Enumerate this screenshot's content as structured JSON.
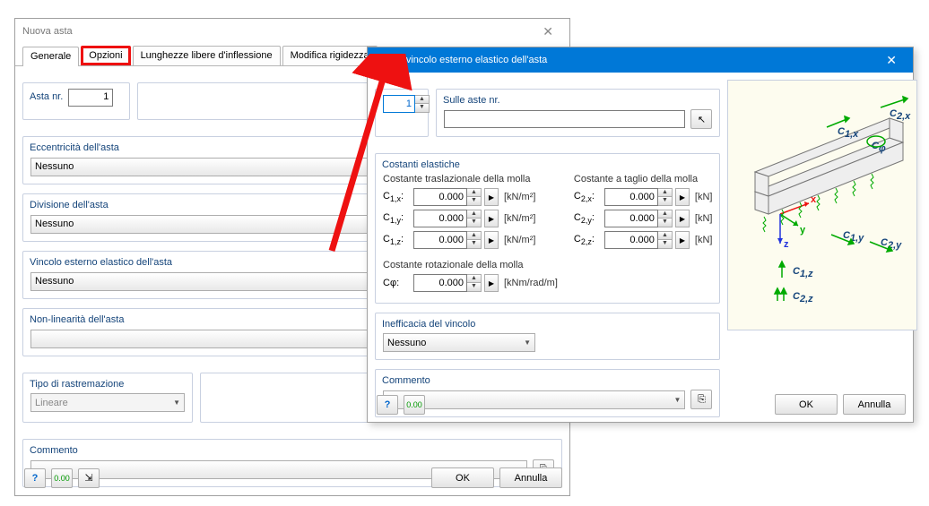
{
  "main": {
    "title": "Nuova asta",
    "tabs": {
      "general": "Generale",
      "options": "Opzioni",
      "buckling": "Lunghezze libere d'inflessione",
      "modify": "Modifica rigidezza"
    },
    "asta_nr": {
      "label": "Asta nr.",
      "value": "1"
    },
    "eccentricity": {
      "label": "Eccentricità dell'asta",
      "value": "Nessuno"
    },
    "division": {
      "label": "Divisione dell'asta",
      "value": "Nessuno"
    },
    "elastic": {
      "label": "Vincolo esterno elastico dell'asta",
      "value": "Nessuno"
    },
    "nonlin": {
      "label": "Non-linearità dell'asta",
      "value": ""
    },
    "taper": {
      "label": "Tipo di rastremazione",
      "value": "Lineare"
    },
    "comment": {
      "label": "Commento",
      "value": ""
    },
    "ok": "OK",
    "cancel": "Annulla"
  },
  "dialog": {
    "title": "Nuovo vincolo esterno elastico dell'asta",
    "nr_value": "1",
    "on_members": {
      "label": "Sulle aste nr.",
      "value": ""
    },
    "constants": {
      "group": "Costanti elastiche",
      "trans": "Costante traslazionale della molla",
      "shear": "Costante a taglio della molla",
      "c1x": "C",
      "c1x_sub": "1,x",
      "c1y_sub": "1,y",
      "c1z_sub": "1,z",
      "c2x_sub": "2,x",
      "c2y_sub": "2,y",
      "c2z_sub": "2,z",
      "rot": "Costante rotazionale della molla",
      "cphi": "Cφ:",
      "val": "0.000",
      "u_knm2": "[kN/m²]",
      "u_kn": "[kN]",
      "u_rot": "[kNm/rad/m]"
    },
    "ineff": {
      "label": "Inefficacia del vincolo",
      "value": "Nessuno"
    },
    "comment": {
      "label": "Commento",
      "value": ""
    },
    "ok": "OK",
    "cancel": "Annulla"
  }
}
